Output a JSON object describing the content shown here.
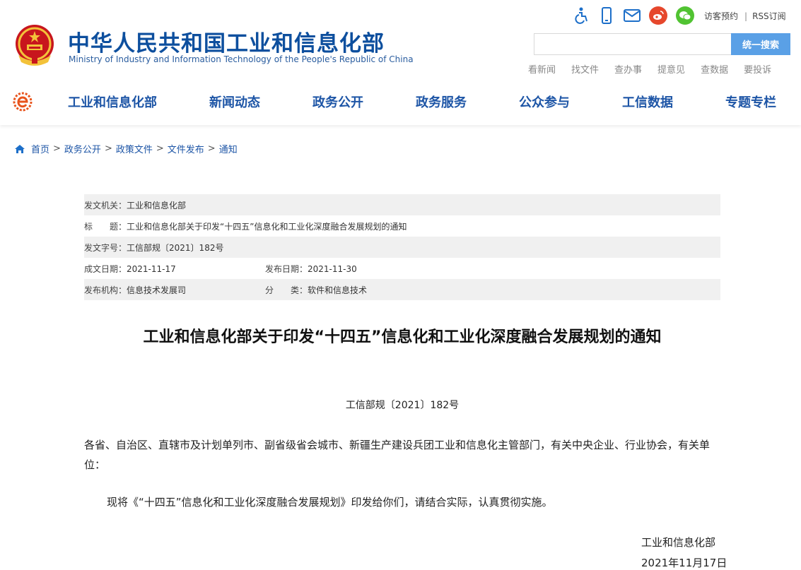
{
  "header": {
    "site_name_cn": "中华人民共和国工业和信息化部",
    "site_name_en": "Ministry of Industry and Information Technology of the People's Republic of China",
    "emblem_icon": "national-emblem-icon",
    "top_icons": [
      "accessibility-icon",
      "mobile-icon",
      "mail-icon",
      "weibo-icon",
      "wechat-icon"
    ],
    "top_links": {
      "visit": "访客预约",
      "divider": "|",
      "rss": "RSS订阅"
    },
    "search": {
      "placeholder": "",
      "button_label": "统一搜索"
    },
    "quick_links": [
      "看新闻",
      "找文件",
      "查办事",
      "提意见",
      "查数据",
      "要投诉"
    ],
    "colors": {
      "brand_blue": "#0d4f9e",
      "nav_blue": "#1d55a6",
      "search_button": "#5aa0e6",
      "emblem_red": "#c8161d"
    }
  },
  "nav": {
    "logo_icon": "miit-logo-icon",
    "items": [
      "工业和信息化部",
      "新闻动态",
      "政务公开",
      "政务服务",
      "公众参与",
      "工信数据",
      "专题专栏"
    ]
  },
  "breadcrumb": {
    "home_icon": "home-icon",
    "items": [
      "首页",
      "政务公开",
      "政策文件",
      "文件发布",
      "通知"
    ],
    "separator": ">"
  },
  "meta": {
    "issuer_label": "发文机关：",
    "issuer": "工业和信息化部",
    "title_label": "标　　题：",
    "title": "工业和信息化部关于印发“十四五”信息化和工业化深度融合发展规划的通知",
    "docno_label": "发文字号：",
    "docno": "工信部规〔2021〕182号",
    "created_label": "成文日期：",
    "created": "2021-11-17",
    "published_label": "发布日期：",
    "published": "2021-11-30",
    "org_label": "发布机构：",
    "org": "信息技术发展司",
    "category_label": "分　　类：",
    "category": "软件和信息技术"
  },
  "article": {
    "title": "工业和信息化部关于印发“十四五”信息化和工业化深度融合发展规划的通知",
    "doc_number": "工信部规〔2021〕182号",
    "recipients": "各省、自治区、直辖市及计划单列市、副省级省会城市、新疆生产建设兵团工业和信息化主管部门，有关中央企业、行业协会，有关单位：",
    "body": "现将《“十四五”信息化和工业化深度融合发展规划》印发给你们，请结合实际，认真贯彻实施。",
    "signature": "工业和信息化部",
    "date": "2021年11月17日"
  }
}
